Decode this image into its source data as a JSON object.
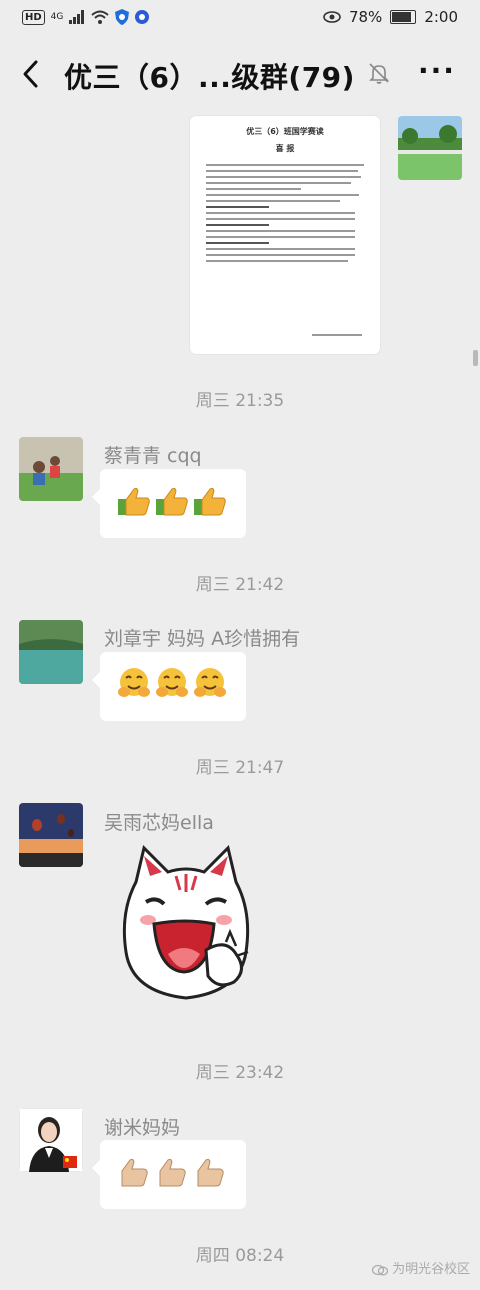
{
  "status_bar": {
    "network": "HD",
    "signal_label": "4G",
    "battery_percent": "78%",
    "battery_level": 0.78,
    "time": "2:00"
  },
  "header": {
    "title": "优三（6）...级群(79)"
  },
  "document": {
    "title": "优三（6）班国学赛读",
    "subtitle": "喜  报"
  },
  "messages": [
    {
      "timestamp": "周三 21:35"
    },
    {
      "timestamp": "周三 21:42",
      "sender": "蔡青青  cqq",
      "content": "thumbs-up-emoji x3"
    },
    {
      "timestamp": "周三 21:47",
      "sender": "刘章宇 妈妈    A珍惜拥有",
      "content": "hugging-face-emoji x3"
    },
    {
      "timestamp": "周三 23:42",
      "sender": "吴雨芯妈ella",
      "content": "cat-sticker"
    },
    {
      "timestamp": "周四 08:24",
      "sender": "谢米妈妈",
      "content": "thumbs-up-emoji x3"
    }
  ],
  "watermark": "为明光谷校区",
  "colors": {
    "background": "#ededed",
    "bubble": "#ffffff",
    "timestamp": "#9a9a9a"
  }
}
